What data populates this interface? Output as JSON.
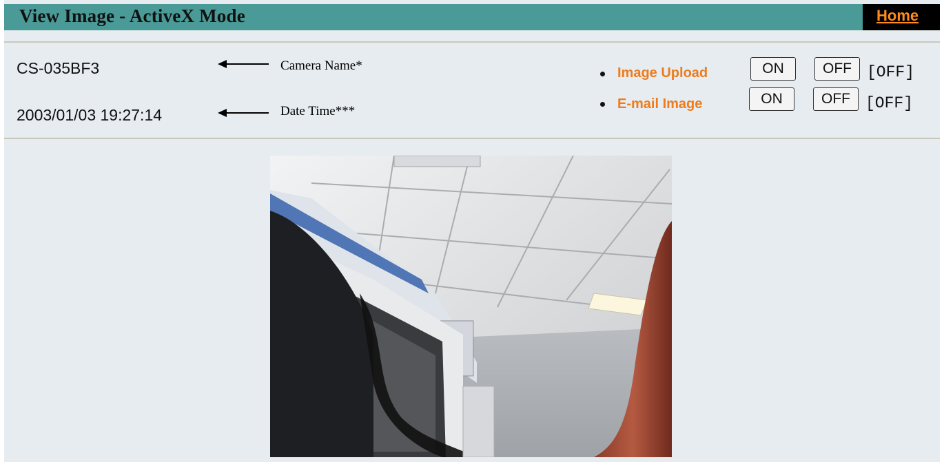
{
  "header": {
    "title": "View Image - ActiveX Mode",
    "home_label": "Home"
  },
  "camera": {
    "name": "CS-035BF3",
    "datetime": "2003/01/03 19:27:14"
  },
  "annotations": {
    "camera_name": "Camera Name*",
    "date_time": "Date Time***"
  },
  "controls": [
    {
      "label": "Image Upload",
      "on_label": "ON",
      "off_label": "OFF",
      "state": "[OFF]"
    },
    {
      "label": "E-mail Image",
      "on_label": "ON",
      "off_label": "OFF",
      "state": "[OFF]"
    }
  ],
  "colors": {
    "titlebar": "#4a9a98",
    "accent": "#f07b1a",
    "background": "#e6ecf0"
  }
}
